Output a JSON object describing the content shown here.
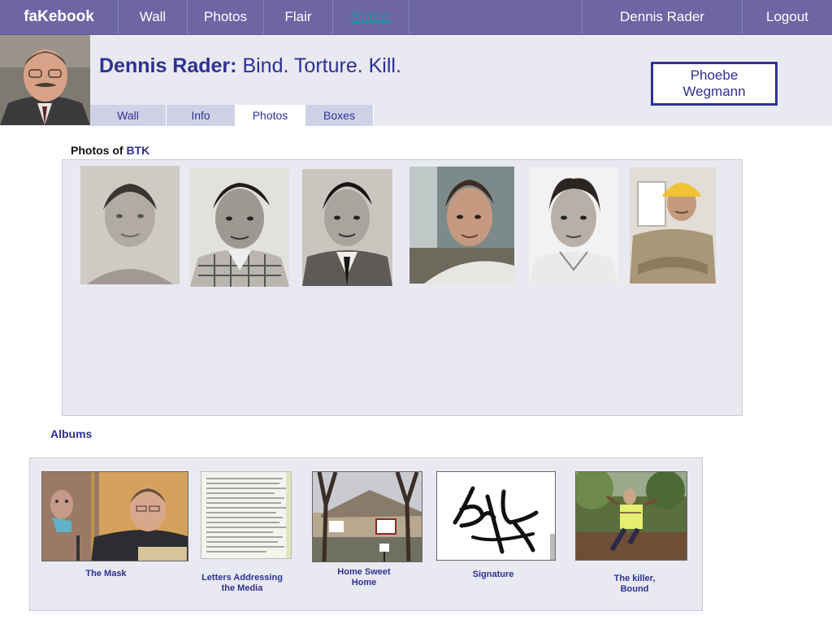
{
  "topnav": {
    "logo": "faKebook",
    "items": [
      {
        "label": "Wall"
      },
      {
        "label": "Photos"
      },
      {
        "label": "Flair"
      },
      {
        "label": "Status"
      }
    ],
    "active_item": "Status",
    "user": "Dennis Rader",
    "logout": "Logout"
  },
  "profile": {
    "name": "Dennis Rader:",
    "motto": "Bind. Torture. Kill.",
    "friend": "Phoebe Wegmann",
    "tabs": [
      {
        "label": "Wall"
      },
      {
        "label": "Info"
      },
      {
        "label": "Photos"
      },
      {
        "label": "Boxes"
      }
    ],
    "active_tab": "Photos"
  },
  "photos": {
    "heading_prefix": "Photos of",
    "owner": "BTK",
    "count": 6
  },
  "albums": {
    "heading": "Albums",
    "items": [
      {
        "caption": "The Mask"
      },
      {
        "caption": "Letters Addressing\nthe Media"
      },
      {
        "caption": "Home Sweet\nHome"
      },
      {
        "caption": "Signature"
      },
      {
        "caption": "The killer,\nBound"
      }
    ]
  },
  "colors": {
    "nav_bg": "#6d66a3",
    "header_bg": "#e8e9f1",
    "brand_text": "#2e3192",
    "active_link": "#1a9aa0"
  }
}
